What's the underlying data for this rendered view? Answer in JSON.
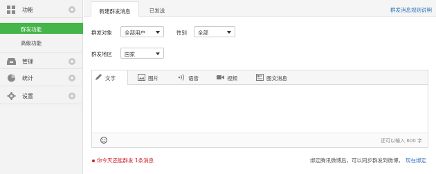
{
  "sidebar": {
    "sections": [
      {
        "label": "功能",
        "icon": "function-grid-icon"
      },
      {
        "label": "管理",
        "icon": "inbox-icon"
      },
      {
        "label": "统计",
        "icon": "pie-chart-icon"
      },
      {
        "label": "设置",
        "icon": "gear-icon"
      }
    ],
    "function_items": [
      {
        "label": "群发功能",
        "active": true
      },
      {
        "label": "高级功能",
        "active": false
      }
    ]
  },
  "tabs": [
    {
      "label": "新建群发消息",
      "active": true
    },
    {
      "label": "已发送",
      "active": false
    }
  ],
  "rule_link": "群发消息规则说明",
  "form": {
    "target_label": "群发对象",
    "target_value": "全部用户",
    "gender_label": "性别",
    "gender_value": "全部",
    "region_label": "群发地区",
    "region_value": "国家"
  },
  "editor": {
    "toolbar": [
      {
        "label": "文字",
        "icon": "pencil-icon",
        "active": true
      },
      {
        "label": "图片",
        "icon": "image-icon",
        "active": false
      },
      {
        "label": "语音",
        "icon": "audio-icon",
        "active": false
      },
      {
        "label": "视频",
        "icon": "video-icon",
        "active": false
      },
      {
        "label": "图文消息",
        "icon": "article-icon",
        "active": false
      }
    ],
    "char_count": "还可以输入 600 字",
    "emoji_icon": "smile-icon"
  },
  "footer": {
    "quota_text": "你今天还能群发 1条消息",
    "bind_text": "绑定腾讯微博后，可以同步群发到微博，",
    "bind_link": "现在绑定"
  },
  "colors": {
    "active_green": "#44b549",
    "link_blue": "#2e73b8",
    "warning_red": "#d0232b"
  }
}
